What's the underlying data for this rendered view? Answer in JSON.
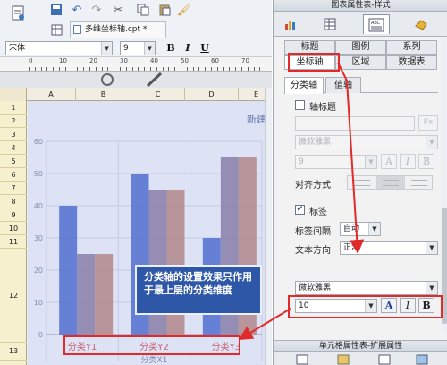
{
  "editor": {
    "file_tab_label": "多维坐标轴.cpt *",
    "font_name": "宋体",
    "font_size": "9",
    "bold_label": "B",
    "italic_label": "I",
    "underline_label": "U",
    "ruler_marks": [
      "0",
      "10",
      "20",
      "30",
      "40",
      "50",
      "60",
      "70"
    ]
  },
  "sheet": {
    "columns": [
      "A",
      "B",
      "C",
      "D",
      "E"
    ],
    "rows": [
      "1",
      "2",
      "3",
      "4",
      "5",
      "6",
      "7",
      "8",
      "9",
      "10",
      "11",
      "12",
      "13"
    ]
  },
  "chart_data": {
    "type": "bar",
    "title": "新建",
    "xlabel": "分类X1",
    "ylabel": "",
    "categories": [
      "分类Y1",
      "分类Y2",
      "分类Y3"
    ],
    "ylim": [
      0,
      60
    ],
    "yticks": [
      0,
      10,
      20,
      30,
      40,
      50,
      60
    ],
    "grid": true,
    "series": [
      {
        "values": [
          40,
          50,
          30
        ],
        "color": "#5b77d3"
      },
      {
        "values": [
          25,
          45,
          55
        ],
        "color": "#8e86ad"
      },
      {
        "values": [
          25,
          45,
          55
        ],
        "color": "#b48e92"
      }
    ]
  },
  "panel": {
    "title": "图表属性表-样式",
    "tabs_row1": [
      "标题",
      "图例",
      "系列"
    ],
    "tabs_row2": [
      "坐标轴",
      "区域",
      "数据表"
    ],
    "sub_tabs": [
      "分类轴",
      "值轴"
    ],
    "axis_title_label": "轴标题",
    "font_disabled": "微软雅黑",
    "size_disabled": "9",
    "format_btn": "Fx",
    "align_label": "对齐方式",
    "label_checkbox": "标签",
    "label_interval_label": "标签间隔",
    "label_interval_value": "自动",
    "text_direction_label": "文本方向",
    "text_direction_value": "正常",
    "label_font": "微软雅黑",
    "label_size": "10",
    "bottom_title": "单元格属性表-扩展属性"
  },
  "annotation": {
    "callout_text": "分类轴的设置效果只作用于最上层的分类维度"
  },
  "colors": {
    "chart_bg": "#dde3f5",
    "callout_bg": "#2f57a8",
    "highlight_red": "#e22a2a"
  }
}
